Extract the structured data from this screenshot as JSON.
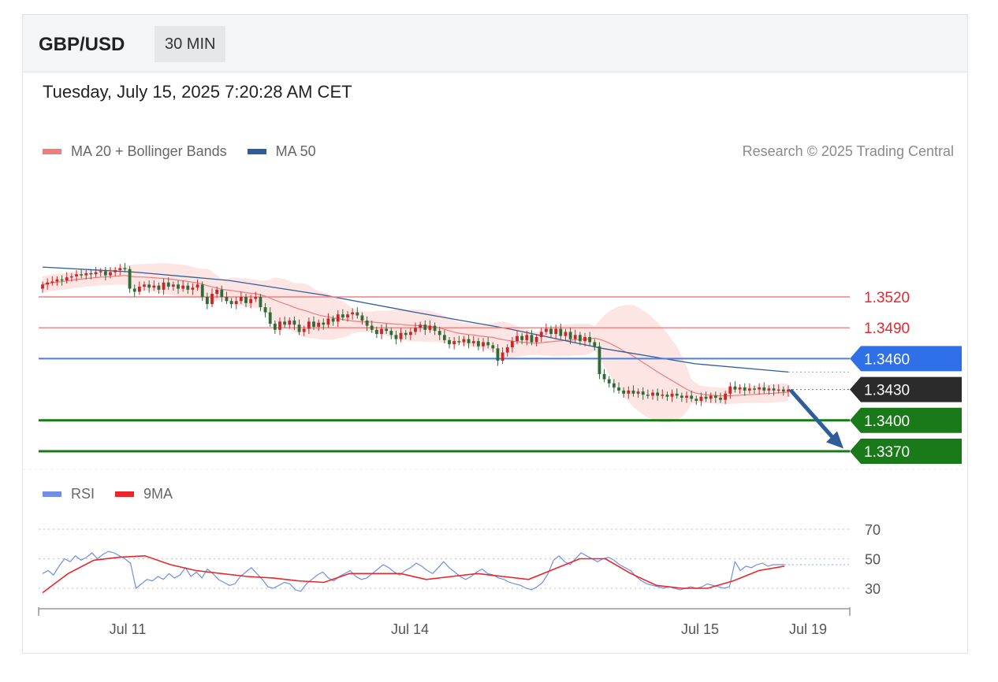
{
  "header": {
    "pair": "GBP/USD",
    "timeframe": "30 MIN",
    "datetime": "Tuesday, July 15, 2025 7:20:28 AM CET",
    "copyright": "Research © 2025 Trading Central"
  },
  "legend": {
    "main": [
      {
        "label": "MA 20 + Bollinger Bands",
        "color": "#f07c7c"
      },
      {
        "label": "MA 50",
        "color": "#2f5d9c"
      }
    ],
    "rsi": [
      {
        "label": "RSI",
        "color": "#6f8fe6"
      },
      {
        "label": "9MA",
        "color": "#e8262b"
      }
    ]
  },
  "colors": {
    "bullish": "#c62828",
    "bearish": "#2e6b38",
    "resistance": "#f08080",
    "pivot": "#4a7fe5",
    "support": "#1a7a1a",
    "current": "#2b2b2b",
    "arrow": "#2f5d9c",
    "band": "#fde0df"
  },
  "chart_data": [
    {
      "type": "candlestick",
      "title": "GBP/USD 30 MIN",
      "x_ticks": [
        "Jul 11",
        "Jul 14",
        "Jul 15",
        "Jul 19"
      ],
      "y_range": [
        1.3355,
        1.357
      ],
      "levels": [
        {
          "label": "1.3520",
          "value": 1.352,
          "role": "resistance"
        },
        {
          "label": "1.3490",
          "value": 1.349,
          "role": "resistance"
        },
        {
          "label": "1.3460",
          "value": 1.346,
          "role": "pivot"
        },
        {
          "label": "1.3430",
          "value": 1.343,
          "role": "current"
        },
        {
          "label": "1.3400",
          "value": 1.34,
          "role": "support"
        },
        {
          "label": "1.3370",
          "value": 1.337,
          "role": "support"
        }
      ],
      "close_series": [
        1.3532,
        1.3534,
        1.3535,
        1.3537,
        1.3536,
        1.3539,
        1.354,
        1.3542,
        1.3541,
        1.3543,
        1.3542,
        1.3544,
        1.3545,
        1.3541,
        1.3544,
        1.3546,
        1.3548,
        1.3547,
        1.3528,
        1.3525,
        1.353,
        1.3532,
        1.3529,
        1.3531,
        1.3527,
        1.3534,
        1.353,
        1.3532,
        1.3528,
        1.3531,
        1.3527,
        1.3529,
        1.3532,
        1.352,
        1.3513,
        1.3523,
        1.3527,
        1.352,
        1.3516,
        1.3513,
        1.3516,
        1.352,
        1.3514,
        1.3518,
        1.352,
        1.351,
        1.3505,
        1.3494,
        1.3488,
        1.3496,
        1.3493,
        1.3497,
        1.3493,
        1.3486,
        1.3489,
        1.3496,
        1.3491,
        1.3495,
        1.3493,
        1.3499,
        1.3496,
        1.3503,
        1.35,
        1.3503,
        1.3505,
        1.3502,
        1.3497,
        1.3492,
        1.3488,
        1.3484,
        1.3489,
        1.3487,
        1.3483,
        1.3479,
        1.3485,
        1.3483,
        1.3486,
        1.349,
        1.3493,
        1.3488,
        1.3492,
        1.3487,
        1.3483,
        1.3478,
        1.3474,
        1.3477,
        1.3476,
        1.3479,
        1.3475,
        1.3477,
        1.3472,
        1.3476,
        1.3473,
        1.347,
        1.3458,
        1.3466,
        1.3471,
        1.3477,
        1.3482,
        1.3478,
        1.3483,
        1.3476,
        1.3481,
        1.3486,
        1.3489,
        1.3484,
        1.3489,
        1.3482,
        1.3486,
        1.3479,
        1.3483,
        1.3477,
        1.3481,
        1.3476,
        1.3472,
        1.3445,
        1.344,
        1.3436,
        1.3432,
        1.3429,
        1.3426,
        1.3429,
        1.3426,
        1.3428,
        1.3425,
        1.3424,
        1.3427,
        1.3424,
        1.3425,
        1.3423,
        1.3426,
        1.3424,
        1.3422,
        1.3424,
        1.3421,
        1.3419,
        1.3423,
        1.3421,
        1.3424,
        1.3422,
        1.342,
        1.3426,
        1.3433,
        1.343,
        1.3432,
        1.3429,
        1.3431,
        1.343,
        1.3432,
        1.3429,
        1.3431,
        1.3429,
        1.343,
        1.3428,
        1.343
      ],
      "ma50": [
        1.3549,
        1.3544,
        1.3536,
        1.3522,
        1.3505,
        1.3489,
        1.347,
        1.3455,
        1.3447
      ],
      "projection": {
        "from": 1.343,
        "to": 1.3375,
        "direction": "down"
      }
    },
    {
      "type": "line",
      "title": "RSI",
      "y_ticks": [
        30,
        50,
        70
      ],
      "y_range": [
        14,
        82
      ],
      "series": [
        {
          "name": "RSI",
          "values": [
            40,
            42,
            39,
            45,
            50,
            48,
            52,
            49,
            51,
            54,
            50,
            53,
            55,
            54,
            52,
            50,
            47,
            30,
            33,
            36,
            35,
            38,
            36,
            40,
            37,
            39,
            44,
            38,
            41,
            37,
            43,
            40,
            36,
            34,
            32,
            33,
            38,
            41,
            44,
            40,
            36,
            31,
            30,
            32,
            34,
            33,
            29,
            28,
            33,
            36,
            39,
            41,
            37,
            35,
            38,
            40,
            42,
            38,
            36,
            37,
            40,
            43,
            46,
            44,
            41,
            39,
            42,
            44,
            47,
            45,
            42,
            40,
            44,
            48,
            44,
            41,
            38,
            36,
            38,
            41,
            43,
            40,
            39,
            37,
            36,
            34,
            33,
            32,
            30,
            29,
            31,
            34,
            40,
            49,
            52,
            48,
            46,
            50,
            54,
            52,
            50,
            48,
            50,
            51,
            49,
            46,
            44,
            42,
            38,
            35,
            33,
            32,
            31,
            30,
            31,
            30,
            29,
            30,
            31,
            30,
            31,
            33,
            32,
            31,
            30,
            31,
            48,
            42,
            45,
            44,
            46,
            47,
            45,
            46,
            46,
            46
          ]
        },
        {
          "name": "9MA",
          "values": [
            27,
            40,
            49,
            51,
            52,
            46,
            42,
            40,
            38,
            37,
            35,
            34,
            40,
            40,
            40,
            36,
            38,
            40,
            38,
            36,
            43,
            50,
            50,
            40,
            32,
            30,
            30,
            35,
            42,
            45
          ]
        }
      ]
    }
  ]
}
